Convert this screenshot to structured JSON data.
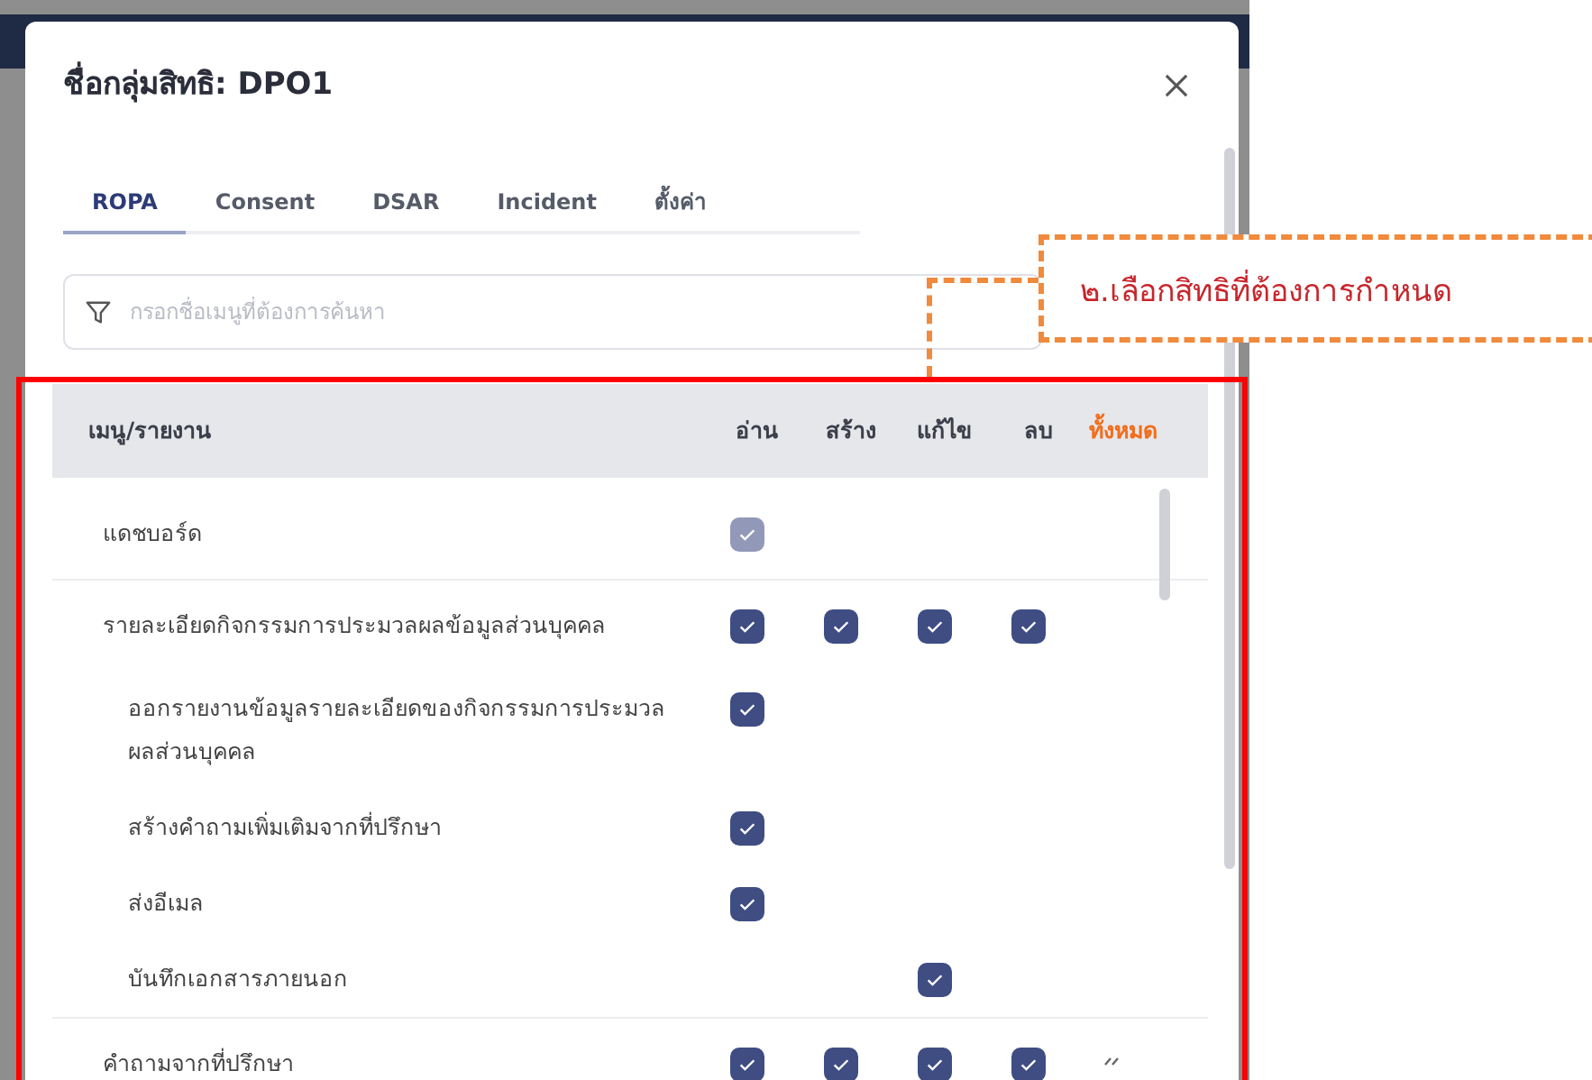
{
  "modal": {
    "title": "ชื่อกลุ่มสิทธิ: DPO1"
  },
  "tabs": [
    {
      "label": "ROPA",
      "selected": true
    },
    {
      "label": "Consent",
      "selected": false
    },
    {
      "label": "DSAR",
      "selected": false
    },
    {
      "label": "Incident",
      "selected": false
    },
    {
      "label": "ตั้งค่า",
      "selected": false
    }
  ],
  "search": {
    "placeholder": "กรอกชื่อเมนูที่ต้องการค้นหา"
  },
  "table": {
    "columns": [
      "เมนู/รายงาน",
      "อ่าน",
      "สร้าง",
      "แก้ไข",
      "ลบ"
    ],
    "all_label": "ทั้งหมด",
    "rows": [
      {
        "kind": "parent",
        "name": "แดชบอร์ด",
        "read": {
          "checked": true,
          "disabled": true
        }
      },
      {
        "kind": "parent",
        "name": "รายละเอียดกิจกรรมการประมวลผลข้อมูลส่วนบุคคล",
        "read": {
          "checked": true,
          "disabled": false
        },
        "create": {
          "checked": true,
          "disabled": false
        },
        "edit": {
          "checked": true,
          "disabled": false
        },
        "delete": {
          "checked": true,
          "disabled": false
        },
        "children": [
          {
            "kind": "child",
            "name": "ออกรายงานข้อมูลรายละเอียดของกิจกรรมการประมวล ผลส่วนบุคคล",
            "read": {
              "checked": true,
              "disabled": false
            }
          },
          {
            "kind": "child",
            "name": "สร้างคำถามเพิ่มเติมจากที่ปรึกษา",
            "read": {
              "checked": true,
              "disabled": false
            }
          },
          {
            "kind": "child",
            "name": "ส่งอีเมล",
            "read": {
              "checked": true,
              "disabled": false
            }
          },
          {
            "kind": "child",
            "name": "บันทึกเอกสารภายนอก",
            "edit": {
              "checked": true,
              "disabled": false
            }
          }
        ]
      },
      {
        "kind": "parent",
        "name": "คำถามจากที่ปรึกษา",
        "expanded": false,
        "read": {
          "checked": true,
          "disabled": false
        },
        "create": {
          "checked": true,
          "disabled": false
        },
        "edit": {
          "checked": true,
          "disabled": false
        },
        "delete": {
          "checked": true,
          "disabled": false
        }
      }
    ]
  },
  "annotation": {
    "text": "๒.เลือกสิทธิที่ต้องการกำหนด"
  }
}
